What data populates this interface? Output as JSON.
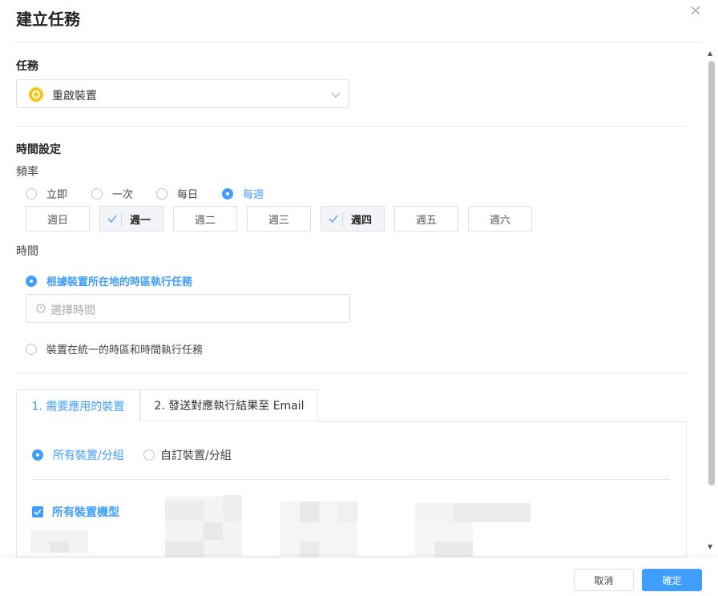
{
  "dialog": {
    "title": "建立任務"
  },
  "task": {
    "section_label": "任務",
    "selected": "重啟裝置"
  },
  "schedule": {
    "section_label": "時間設定",
    "frequency_label": "頻率",
    "frequency_options": [
      "立即",
      "一次",
      "每日",
      "每週"
    ],
    "selected_frequency": "每週",
    "weekdays": [
      {
        "label": "週日",
        "checked": false
      },
      {
        "label": "週一",
        "checked": true
      },
      {
        "label": "週二",
        "checked": false
      },
      {
        "label": "週三",
        "checked": false
      },
      {
        "label": "週四",
        "checked": true
      },
      {
        "label": "週五",
        "checked": false
      },
      {
        "label": "週六",
        "checked": false
      }
    ],
    "time_label": "時間",
    "time_options": [
      "根據裝置所在地的時區執行任務",
      "裝置在統一的時區和時間執行任務"
    ],
    "selected_time_option": "根據裝置所在地的時區執行任務",
    "time_placeholder": "選擇時間"
  },
  "tabs": {
    "items": [
      "1. 需要應用的裝置",
      "2. 發送對應執行結果至 Email"
    ],
    "active": "1. 需要應用的裝置"
  },
  "devices": {
    "scope_options": [
      "所有裝置/分組",
      "自訂裝置/分組"
    ],
    "selected_scope": "所有裝置/分組",
    "all_models_label": "所有裝置機型",
    "all_models_checked": true
  },
  "footer": {
    "cancel_label": "取消",
    "ok_label": "確定"
  },
  "colors": {
    "accent": "#409eff",
    "task_icon": "#f5c518"
  }
}
